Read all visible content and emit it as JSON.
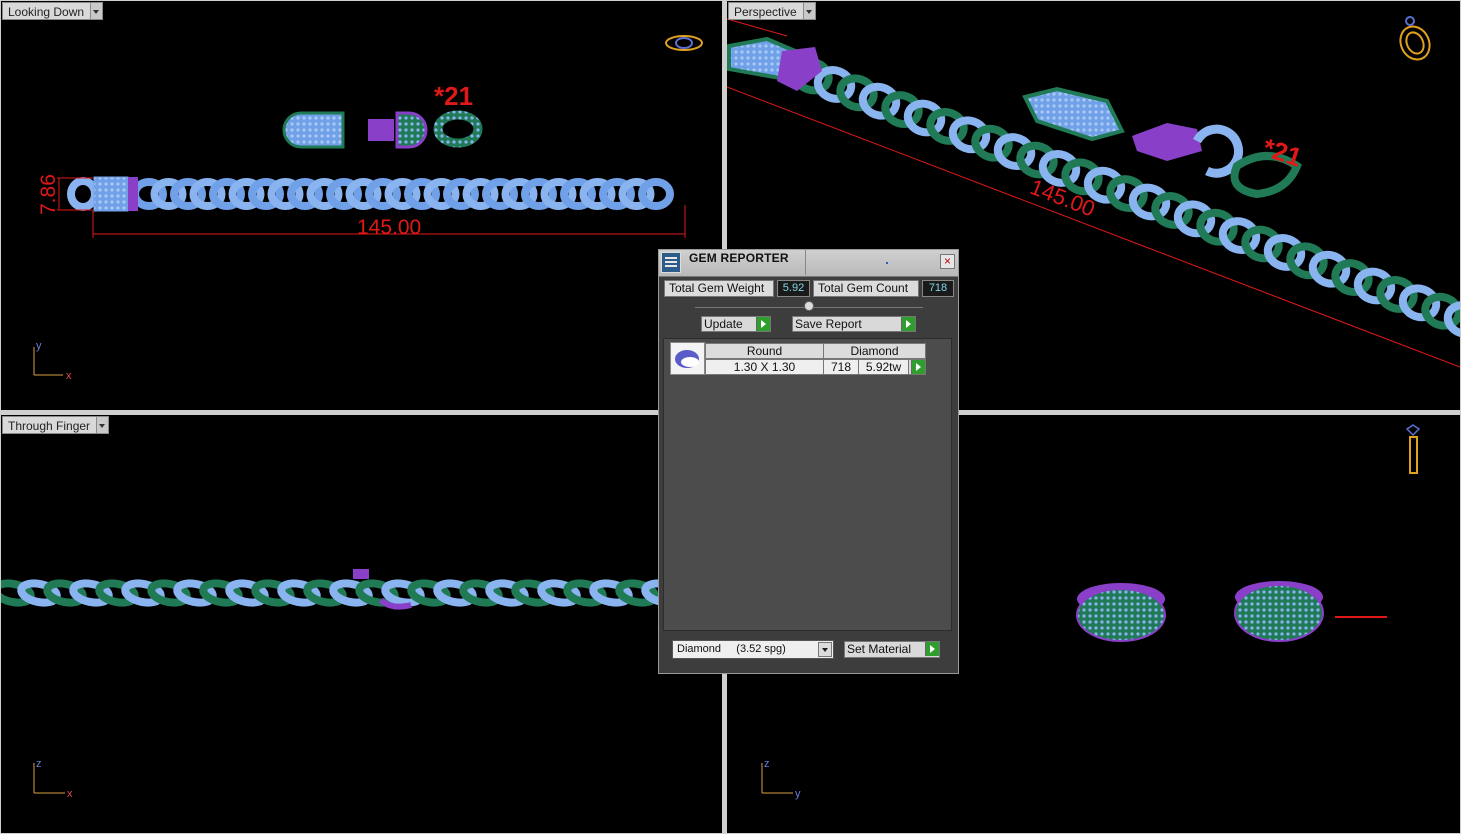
{
  "viewports": {
    "top_left": {
      "label": "Looking Down",
      "dim_width": "145.00",
      "dim_height": "7.86",
      "marker": "*21",
      "axis_v": "y",
      "axis_h": "x"
    },
    "top_right": {
      "label": "Perspective",
      "dim_width": "145.00",
      "marker": "*21"
    },
    "bottom_left": {
      "label": "Through Finger",
      "axis_v": "z",
      "axis_h": "x"
    },
    "bottom_right": {
      "axis_v": "z",
      "axis_h": "y"
    }
  },
  "gem_reporter": {
    "title": "GEM REPORTER",
    "close_label": "×",
    "total_weight_label": "Total Gem Weight",
    "total_weight_value": "5.92",
    "total_count_label": "Total Gem Count",
    "total_count_value": "718",
    "update_label": "Update",
    "save_report_label": "Save Report",
    "rows": [
      {
        "shape": "Round",
        "material": "Diamond",
        "size": "1.30 X 1.30",
        "count": "718",
        "weight": "5.92tw"
      }
    ],
    "material_select": "Diamond     (3.52 spg)",
    "set_material_label": "Set Material"
  },
  "colors": {
    "gem_blue": "#8ab4f0",
    "metal_green": "#1f7a55",
    "purple": "#8a3fc8",
    "dimension_red": "#e01818",
    "background": "#000000",
    "axis_color": "#d8a040"
  },
  "icons": [
    "ring-top-view-icon",
    "ring-perspective-icon",
    "ring-side-icon"
  ]
}
